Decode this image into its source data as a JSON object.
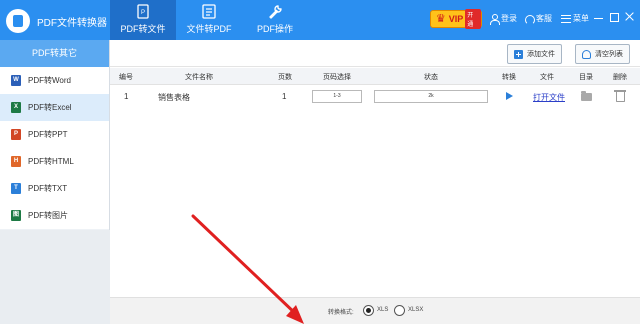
{
  "app": {
    "title": "PDF文件转换器"
  },
  "tabs": [
    {
      "label": "PDF转文件",
      "active": true
    },
    {
      "label": "文件转PDF",
      "active": false
    },
    {
      "label": "PDF操作",
      "active": false
    }
  ],
  "header": {
    "vip_text": "VIP",
    "vip_button": "开通",
    "login": "登录",
    "service": "客服",
    "menu": "菜单"
  },
  "sidebar": {
    "header": "PDF转其它",
    "items": [
      {
        "label": "PDF转Word",
        "icon": "word-icon",
        "color": "#2b5fb8",
        "glyph": "W"
      },
      {
        "label": "PDF转Excel",
        "icon": "excel-icon",
        "color": "#1e7a45",
        "glyph": "X"
      },
      {
        "label": "PDF转PPT",
        "icon": "ppt-icon",
        "color": "#d24726",
        "glyph": "P"
      },
      {
        "label": "PDF转HTML",
        "icon": "html-icon",
        "color": "#e0672a",
        "glyph": "H"
      },
      {
        "label": "PDF转TXT",
        "icon": "txt-icon",
        "color": "#2b7fd9",
        "glyph": "T"
      },
      {
        "label": "PDF转图片",
        "icon": "image-icon",
        "color": "#1e7a45",
        "glyph": "图"
      }
    ]
  },
  "toolbar": {
    "add_file": "添加文件",
    "clear_list": "清空列表"
  },
  "table": {
    "columns": [
      "编号",
      "文件名称",
      "页数",
      "页码选择",
      "状态",
      "转换",
      "文件",
      "目录",
      "删除"
    ],
    "rows": [
      {
        "index": "1",
        "name": "销售表格",
        "pages": "1",
        "page_range": "1-3",
        "status": "2k",
        "open": "打开文件"
      }
    ]
  },
  "format": {
    "label": "转换格式:",
    "options": [
      {
        "label": "XLS",
        "selected": true
      },
      {
        "label": "XLSX",
        "selected": false
      }
    ]
  },
  "colors": {
    "primary": "#2b8ff0",
    "active_tab": "#1f6fc9",
    "sidebar_head": "#5ba9f1",
    "annotation": "#e02020"
  }
}
